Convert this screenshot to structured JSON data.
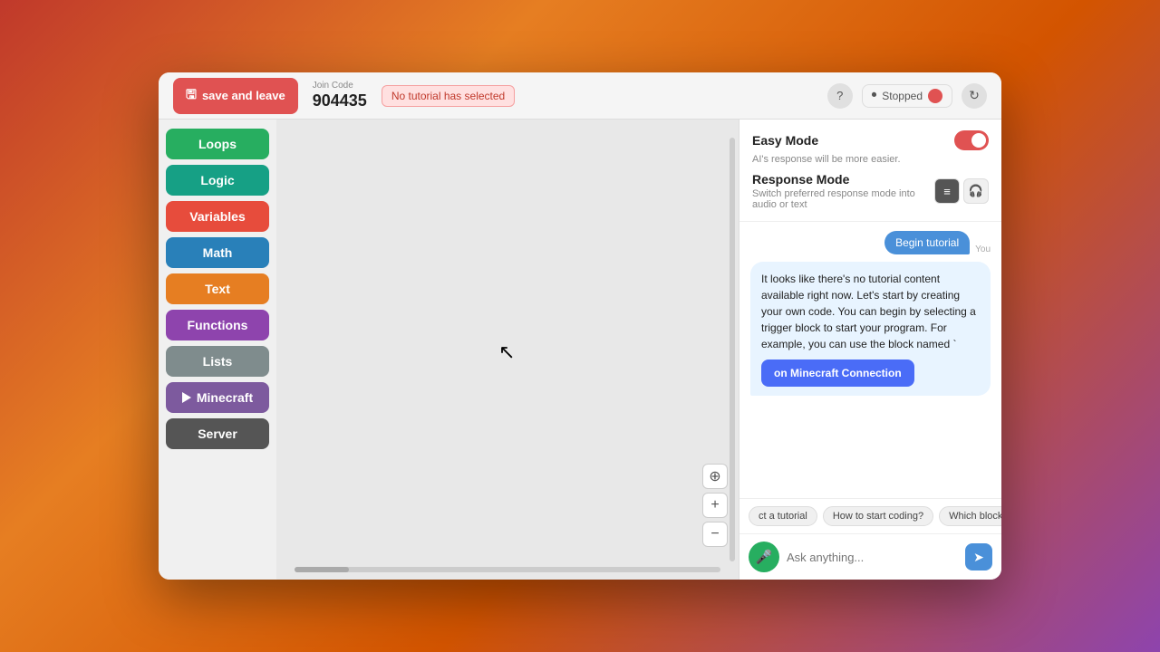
{
  "titlebar": {
    "save_leave_label": "save and leave",
    "join_code_label": "Join Code",
    "join_code_value": "904435",
    "tutorial_badge": "No tutorial has selected",
    "stopped_label": "Stopped",
    "help_icon": "?",
    "refresh_icon": "↻"
  },
  "sidebar": {
    "buttons": [
      {
        "id": "loops",
        "label": "Loops",
        "class": "btn-loops"
      },
      {
        "id": "logic",
        "label": "Logic",
        "class": "btn-logic"
      },
      {
        "id": "variables",
        "label": "Variables",
        "class": "btn-variables"
      },
      {
        "id": "math",
        "label": "Math",
        "class": "btn-math"
      },
      {
        "id": "text",
        "label": "Text",
        "class": "btn-text"
      },
      {
        "id": "functions",
        "label": "Functions",
        "class": "btn-functions"
      },
      {
        "id": "lists",
        "label": "Lists",
        "class": "btn-lists"
      },
      {
        "id": "minecraft",
        "label": "Minecraft",
        "class": "btn-minecraft"
      },
      {
        "id": "server",
        "label": "Server",
        "class": "btn-server"
      }
    ]
  },
  "chat": {
    "easy_mode_title": "Easy Mode",
    "easy_mode_sub": "AI's response will be more easier.",
    "response_mode_title": "Response Mode",
    "response_mode_sub": "Switch preferred response mode into audio or text",
    "messages": [
      {
        "type": "user-btn",
        "text": "Begin tutorial"
      },
      {
        "type": "you-label",
        "text": "You"
      },
      {
        "type": "ai",
        "text": "It looks like there's no tutorial content available right now. Let's start by creating your own code. You can begin by selecting a trigger block to start your program. For example, you can use the block named `",
        "block_btn": "on Minecraft Connection"
      }
    ],
    "suggestions": [
      "ct a tutorial",
      "How to start coding?",
      "Which block to us..."
    ],
    "input_placeholder": "Ask anything...",
    "send_icon": "➤"
  }
}
